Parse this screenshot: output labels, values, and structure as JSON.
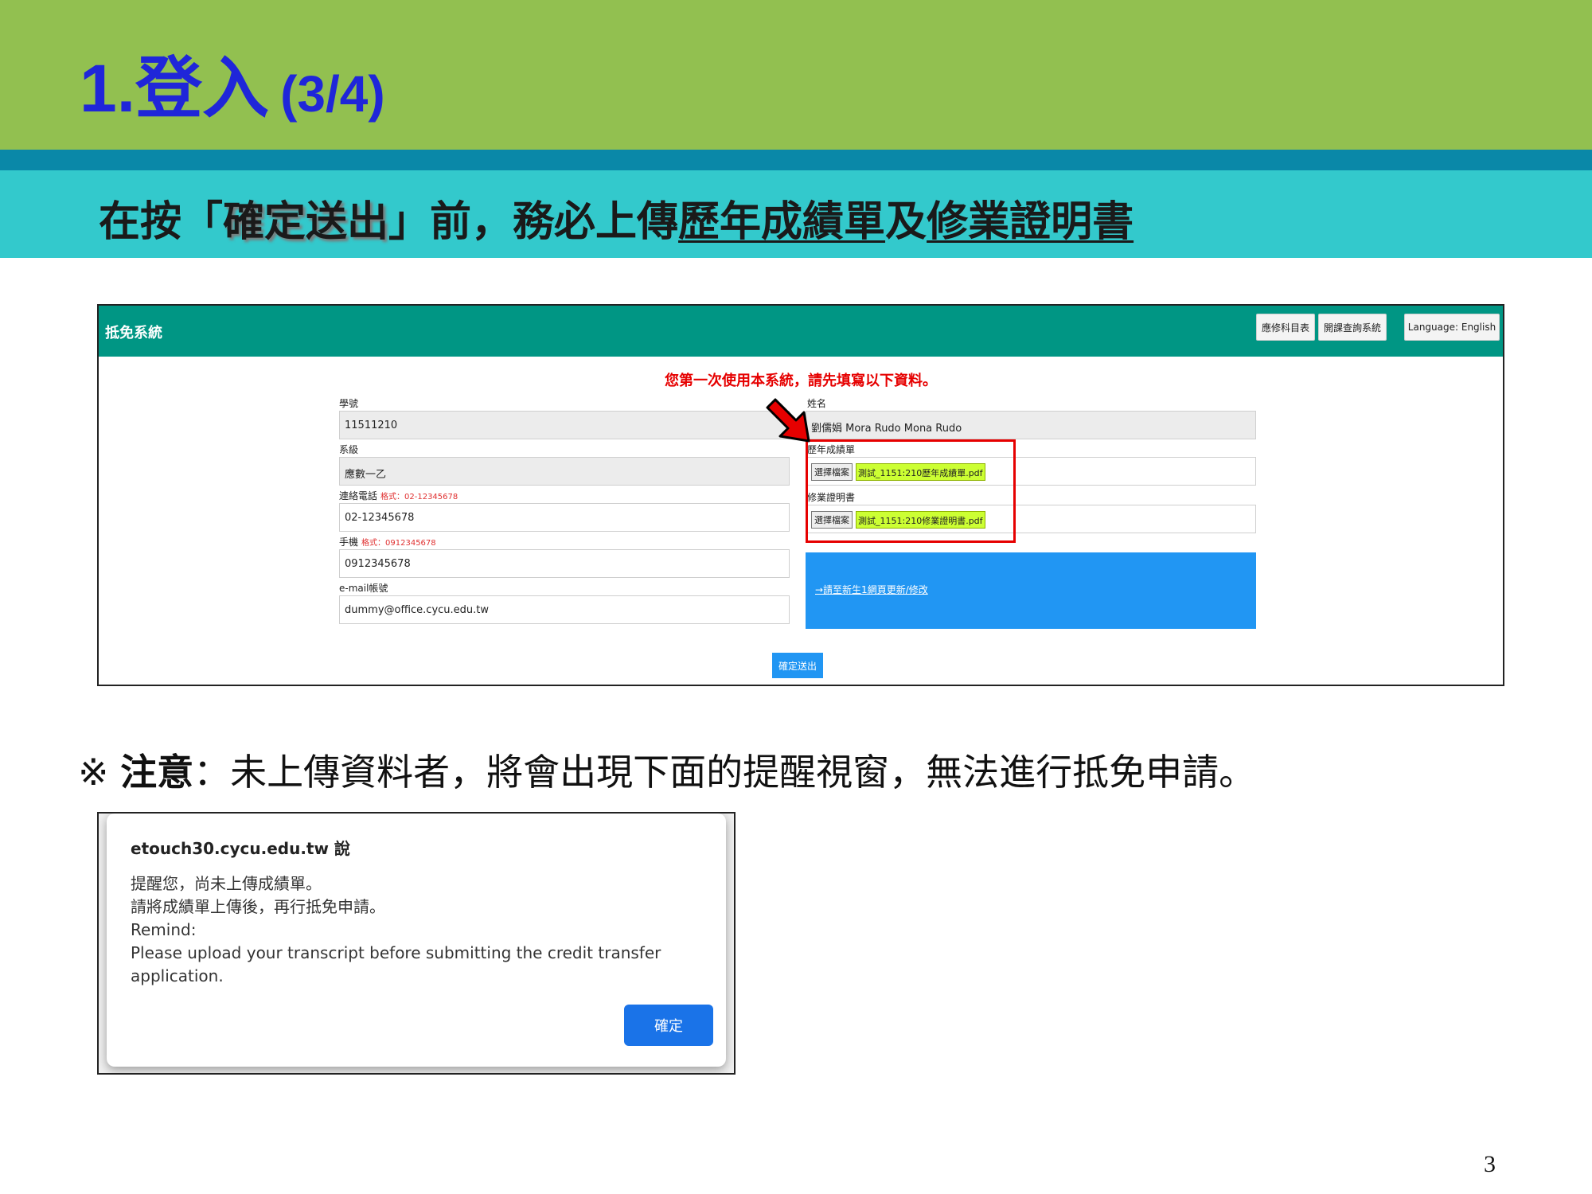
{
  "slide": {
    "title": "1.登入",
    "title_paren": "(3/4)",
    "subtitle_parts": [
      "在按「",
      "確定送出",
      "」前，務必上傳",
      "歷年成績單",
      "及",
      "修業證明書"
    ],
    "note_prefix": "※ ",
    "note_bold": "注意",
    "note_rest": "：未上傳資料者，將會出現下面的提醒視窗，無法進行抵免申請。",
    "page_number": "3"
  },
  "system_page": {
    "brand": "抵免系統",
    "nav_buttons": [
      "應修科目表",
      "開課查詢系統",
      "Language: English"
    ],
    "notice": "您第一次使用本系統，請先填寫以下資料。",
    "fields": {
      "student_id": {
        "label": "學號",
        "value": "11511210"
      },
      "department": {
        "label": "系級",
        "value": "應數一乙"
      },
      "phone": {
        "label": "連絡電話",
        "hint": "格式：02-12345678",
        "value": "02-12345678"
      },
      "mobile": {
        "label": "手機",
        "hint": "格式：0912345678",
        "value": "0912345678"
      },
      "email": {
        "label": "e-mail帳號",
        "value": "dummy@office.cycu.edu.tw"
      },
      "name": {
        "label": "姓名",
        "value": "劉儒娟 Mora Rudo Mona Rudo"
      },
      "transcript": {
        "label": "歷年成績單",
        "button": "選擇檔案",
        "file": "測試_1151:210歷年成績單.pdf"
      },
      "certificate": {
        "label": "修業證明書",
        "button": "選擇檔案",
        "file": "測試_1151:210修業證明書.pdf"
      }
    },
    "blue_link": "→請至新生1網頁更新/修改",
    "submit": "確定送出",
    "colors": {
      "nav": "#009684",
      "highlight": "#e60000",
      "file_bg": "#ccff33",
      "panel": "#2196f3"
    },
    "icons": {
      "pointer": "red-arrow-icon"
    }
  },
  "alert": {
    "title": "etouch30.cycu.edu.tw 說",
    "lines": [
      "提醒您，尚未上傳成績單。",
      "請將成績單上傳後，再行抵免申請。",
      "Remind:",
      "Please upload your transcript before submitting the credit transfer application."
    ],
    "ok": "確定",
    "colors": {
      "ok_button": "#1a73e8"
    }
  }
}
